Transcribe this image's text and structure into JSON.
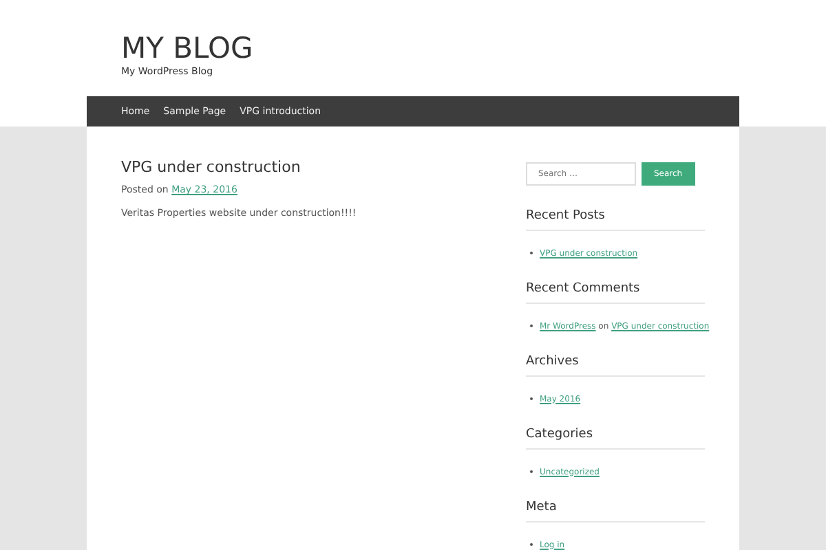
{
  "site": {
    "title": "MY BLOG",
    "tagline": "My WordPress Blog"
  },
  "nav": [
    {
      "label": "Home"
    },
    {
      "label": "Sample Page"
    },
    {
      "label": "VPG introduction"
    }
  ],
  "post": {
    "title": "VPG under construction",
    "posted_prefix": "Posted on",
    "date": "May 23, 2016",
    "body": "Veritas Properties website under construction!!!!"
  },
  "search": {
    "placeholder": "Search …",
    "button": "Search"
  },
  "widgets": [
    {
      "kind": "links",
      "title": "Recent Posts",
      "items": [
        "VPG under construction"
      ]
    },
    {
      "kind": "comments",
      "title": "Recent Comments",
      "items": [
        {
          "author": "Mr WordPress",
          "joiner": "on",
          "post": "VPG under construction"
        }
      ]
    },
    {
      "kind": "links",
      "title": "Archives",
      "items": [
        "May 2016"
      ]
    },
    {
      "kind": "links",
      "title": "Categories",
      "items": [
        "Uncategorized"
      ]
    },
    {
      "kind": "links",
      "title": "Meta",
      "items": [
        "Log in"
      ]
    }
  ]
}
